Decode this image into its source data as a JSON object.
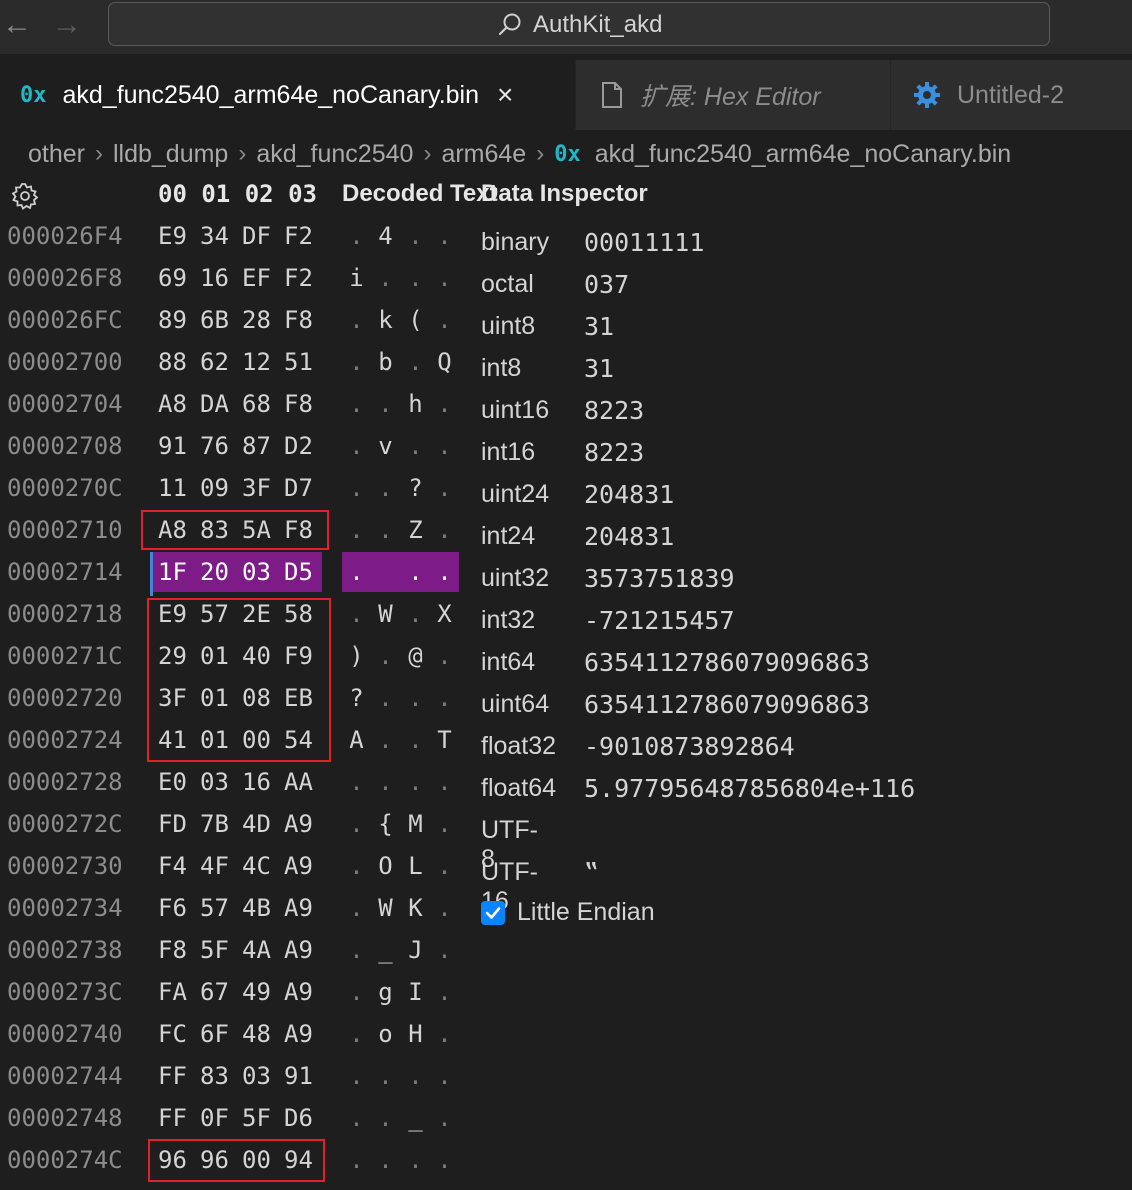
{
  "window": {
    "title": "AuthKit_akd"
  },
  "tabs": [
    {
      "icon": "hex-file-icon",
      "label": "akd_func2540_arm64e_noCanary.bin",
      "active": true
    },
    {
      "icon": "file-icon",
      "label": "扩展: Hex Editor",
      "active": false
    },
    {
      "icon": "gear-icon",
      "label": "Untitled-2",
      "active": false
    }
  ],
  "breadcrumb": [
    "other",
    "lldb_dump",
    "akd_func2540",
    "arm64e",
    "akd_func2540_arm64e_noCanary.bin"
  ],
  "hex": {
    "column_header": [
      "00",
      "01",
      "02",
      "03"
    ],
    "decoded_header": "Decoded Text",
    "rows": [
      {
        "addr": "000026F4",
        "bytes": [
          "E9",
          "34",
          "DF",
          "F2"
        ],
        "text": [
          ".",
          "4",
          ".",
          "."
        ]
      },
      {
        "addr": "000026F8",
        "bytes": [
          "69",
          "16",
          "EF",
          "F2"
        ],
        "text": [
          "i",
          ".",
          ".",
          "."
        ]
      },
      {
        "addr": "000026FC",
        "bytes": [
          "89",
          "6B",
          "28",
          "F8"
        ],
        "text": [
          ".",
          "k",
          "(",
          "."
        ]
      },
      {
        "addr": "00002700",
        "bytes": [
          "88",
          "62",
          "12",
          "51"
        ],
        "text": [
          ".",
          "b",
          ".",
          "Q"
        ]
      },
      {
        "addr": "00002704",
        "bytes": [
          "A8",
          "DA",
          "68",
          "F8"
        ],
        "text": [
          ".",
          ".",
          "h",
          "."
        ]
      },
      {
        "addr": "00002708",
        "bytes": [
          "91",
          "76",
          "87",
          "D2"
        ],
        "text": [
          ".",
          "v",
          ".",
          "."
        ]
      },
      {
        "addr": "0000270C",
        "bytes": [
          "11",
          "09",
          "3F",
          "D7"
        ],
        "text": [
          ".",
          ".",
          "?",
          "."
        ]
      },
      {
        "addr": "00002710",
        "bytes": [
          "A8",
          "83",
          "5A",
          "F8"
        ],
        "text": [
          ".",
          ".",
          "Z",
          "."
        ]
      },
      {
        "addr": "00002714",
        "bytes": [
          "1F",
          "20",
          "03",
          "D5"
        ],
        "text": [
          ".",
          "",
          " ",
          ".",
          "."
        ]
      },
      {
        "addr": "00002718",
        "bytes": [
          "E9",
          "57",
          "2E",
          "58"
        ],
        "text": [
          ".",
          "W",
          ".",
          "X"
        ]
      },
      {
        "addr": "0000271C",
        "bytes": [
          "29",
          "01",
          "40",
          "F9"
        ],
        "text": [
          ")",
          ".",
          "@",
          "."
        ]
      },
      {
        "addr": "00002720",
        "bytes": [
          "3F",
          "01",
          "08",
          "EB"
        ],
        "text": [
          "?",
          ".",
          ".",
          "."
        ]
      },
      {
        "addr": "00002724",
        "bytes": [
          "41",
          "01",
          "00",
          "54"
        ],
        "text": [
          "A",
          ".",
          ".",
          "T"
        ]
      },
      {
        "addr": "00002728",
        "bytes": [
          "E0",
          "03",
          "16",
          "AA"
        ],
        "text": [
          ".",
          ".",
          ".",
          "."
        ]
      },
      {
        "addr": "0000272C",
        "bytes": [
          "FD",
          "7B",
          "4D",
          "A9"
        ],
        "text": [
          ".",
          "{",
          "M",
          "."
        ]
      },
      {
        "addr": "00002730",
        "bytes": [
          "F4",
          "4F",
          "4C",
          "A9"
        ],
        "text": [
          ".",
          "O",
          "L",
          "."
        ]
      },
      {
        "addr": "00002734",
        "bytes": [
          "F6",
          "57",
          "4B",
          "A9"
        ],
        "text": [
          ".",
          "W",
          "K",
          "."
        ]
      },
      {
        "addr": "00002738",
        "bytes": [
          "F8",
          "5F",
          "4A",
          "A9"
        ],
        "text": [
          ".",
          "_",
          "J",
          "."
        ]
      },
      {
        "addr": "0000273C",
        "bytes": [
          "FA",
          "67",
          "49",
          "A9"
        ],
        "text": [
          ".",
          "g",
          "I",
          "."
        ]
      },
      {
        "addr": "00002740",
        "bytes": [
          "FC",
          "6F",
          "48",
          "A9"
        ],
        "text": [
          ".",
          "o",
          "H",
          "."
        ]
      },
      {
        "addr": "00002744",
        "bytes": [
          "FF",
          "83",
          "03",
          "91"
        ],
        "text": [
          ".",
          ".",
          ".",
          "."
        ]
      },
      {
        "addr": "00002748",
        "bytes": [
          "FF",
          "0F",
          "5F",
          "D6"
        ],
        "text": [
          ".",
          ".",
          "_",
          "."
        ]
      },
      {
        "addr": "0000274C",
        "bytes": [
          "96",
          "96",
          "00",
          "94"
        ],
        "text": [
          ".",
          ".",
          ".",
          "."
        ]
      }
    ],
    "selected_addr": "00002714",
    "highlight_color": "#7d1c86",
    "annotation_color": "#e0202a"
  },
  "inspector": {
    "title": "Data Inspector",
    "fields": [
      {
        "label": "binary",
        "value": "00011111"
      },
      {
        "label": "octal",
        "value": "037"
      },
      {
        "label": "uint8",
        "value": "31"
      },
      {
        "label": "int8",
        "value": "31"
      },
      {
        "label": "uint16",
        "value": "8223"
      },
      {
        "label": "int16",
        "value": "8223"
      },
      {
        "label": "uint24",
        "value": "204831"
      },
      {
        "label": "int24",
        "value": "204831"
      },
      {
        "label": "uint32",
        "value": "3573751839"
      },
      {
        "label": "int32",
        "value": "-721215457"
      },
      {
        "label": "int64",
        "value": "6354112786079096863"
      },
      {
        "label": "uint64",
        "value": "6354112786079096863"
      },
      {
        "label": "float32",
        "value": "-9010873892864"
      },
      {
        "label": "float64",
        "value": "5.977956487856804e+116"
      },
      {
        "label": "UTF-8",
        "value": ""
      },
      {
        "label": "UTF-16",
        "value": "‟"
      }
    ],
    "little_endian_label": "Little Endian",
    "little_endian_checked": true
  }
}
